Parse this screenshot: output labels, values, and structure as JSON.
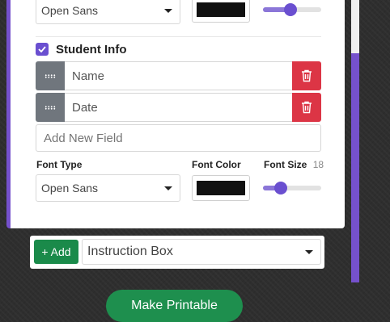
{
  "top_row": {
    "font_type_value": "Open Sans",
    "font_color": "#111111",
    "font_size_fraction": 0.5
  },
  "student_info": {
    "checked": true,
    "title": "Student Info",
    "fields": [
      {
        "label": "Name"
      },
      {
        "label": "Date"
      }
    ],
    "new_field_placeholder": "Add New Field",
    "font_type_label": "Font Type",
    "font_color_label": "Font Color",
    "font_size_label": "Font Size",
    "font_size_value": "18",
    "font_type_value": "Open Sans",
    "font_color": "#111111",
    "font_size_fraction": 0.4
  },
  "add_section": {
    "add_label": "+ Add",
    "selected_option": "Instruction Box"
  },
  "make_printable_label": "Make Printable",
  "colors": {
    "accent_purple": "#7551cc",
    "delete_red": "#dc3545",
    "add_green": "#1a8a4a",
    "handle_gray": "#70767d"
  }
}
